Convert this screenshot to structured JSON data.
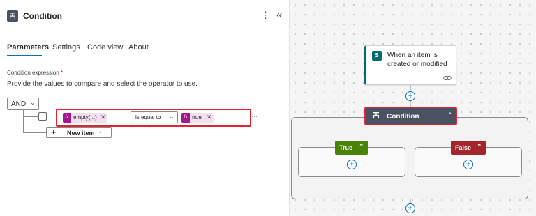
{
  "panel": {
    "title": "Condition",
    "more_glyph": "⋮",
    "collapse_glyph": "«",
    "tabs": [
      {
        "label": "Parameters"
      },
      {
        "label": "Settings"
      },
      {
        "label": "Code view"
      },
      {
        "label": "About"
      }
    ],
    "condition_label": "Condition expression",
    "required_mark": "*",
    "description": "Provide the values to compare and select the operator to use.",
    "group_operator": "AND",
    "row": {
      "left_value": "empty(...)",
      "operator": "is equal to",
      "right_value": "true",
      "fx_label": "fx",
      "remove_glyph": "✕",
      "more_glyph": "···"
    },
    "new_item_label": "New item"
  },
  "canvas": {
    "trigger": {
      "icon_text": "S",
      "label": "When an item is created or modified"
    },
    "condition": {
      "label": "Condition"
    },
    "branch_true": {
      "label": "True"
    },
    "branch_false": {
      "label": "False"
    },
    "plus_glyph": "+"
  },
  "colors": {
    "accent": "#0f6cbd",
    "highlight": "#e0242f",
    "condition_node": "#4a5261",
    "true_branch": "#498205",
    "false_branch": "#a4262c",
    "expression_token": "#a4168a",
    "sharepoint": "#036c70"
  },
  "icons": {
    "header": "condition-icon",
    "trigger": "sharepoint-icon",
    "link": "link-icon",
    "chevron": "chevron-down-icon"
  }
}
